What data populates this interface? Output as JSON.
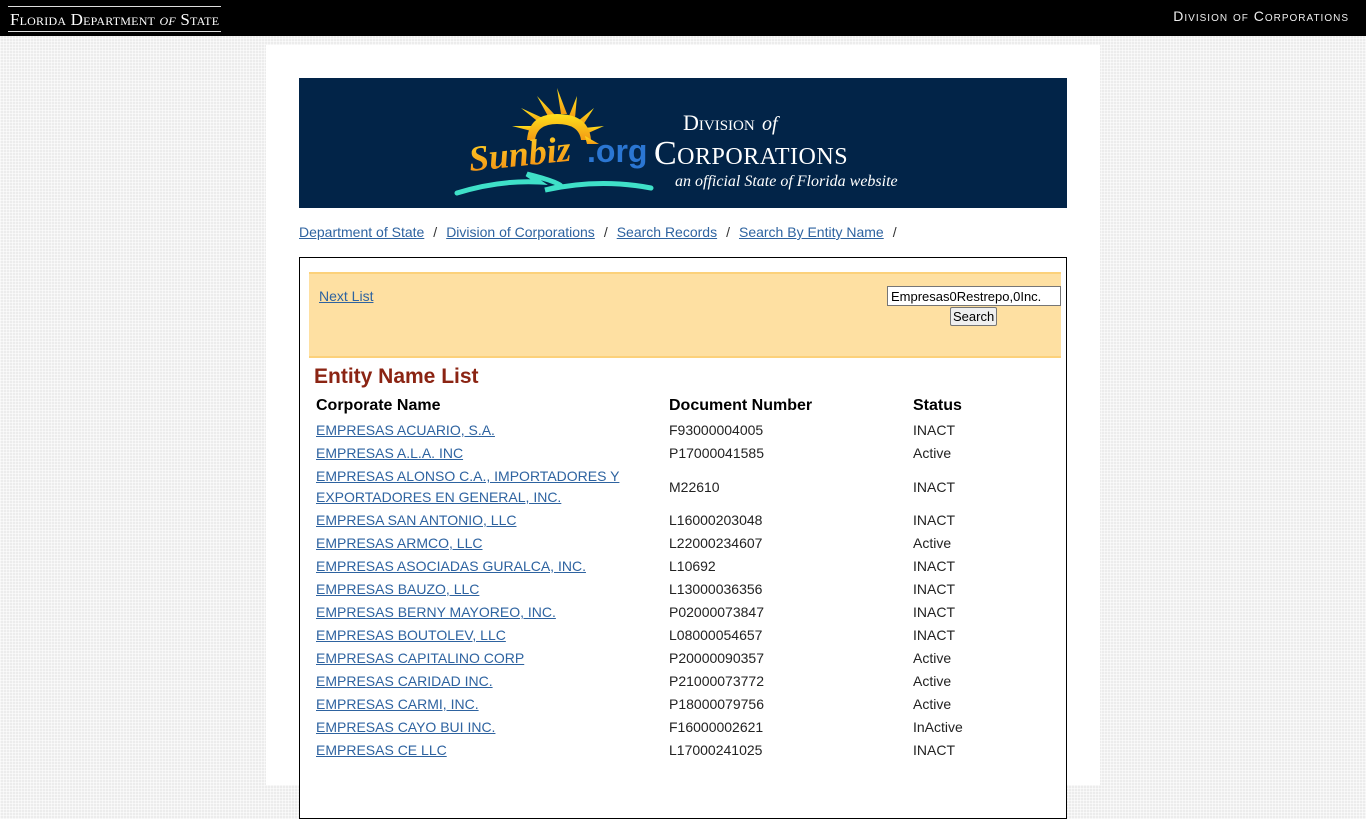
{
  "topbar": {
    "left_title_part1": "Florida Department",
    "left_title_of": "of",
    "left_title_part2": "State",
    "right_title": "Division of Corporations"
  },
  "banner": {
    "logo_text": "Sunbiz",
    "logo_suffix": ".org",
    "division_line": "Division",
    "division_of": "of",
    "corporations": "Corporations",
    "tagline": "an official State of Florida website",
    "colors": {
      "background": "#022448",
      "sun": "#f7c21a",
      "swoosh": "#3fe0c8",
      "org": "#2b76d2"
    }
  },
  "breadcrumb": [
    {
      "label": "Department of State"
    },
    {
      "label": "Division of Corporations"
    },
    {
      "label": "Search Records"
    },
    {
      "label": "Search By Entity Name"
    }
  ],
  "breadcrumb_separator": "/",
  "search": {
    "next_list_label": "Next List",
    "input_value": "Empresas0Restrepo,0Inc.",
    "button_label": "Search"
  },
  "list": {
    "title": "Entity Name List",
    "columns": [
      "Corporate Name",
      "Document Number",
      "Status"
    ],
    "rows": [
      {
        "name": "EMPRESAS ACUARIO, S.A.",
        "doc": "F93000004005",
        "status": "INACT"
      },
      {
        "name": "EMPRESAS A.L.A. INC",
        "doc": "P17000041585",
        "status": "Active"
      },
      {
        "name": "EMPRESAS ALONSO C.A., IMPORTADORES Y EXPORTADORES EN GENERAL, INC.",
        "doc": "M22610",
        "status": "INACT"
      },
      {
        "name": "EMPRESA SAN ANTONIO, LLC",
        "doc": "L16000203048",
        "status": "INACT"
      },
      {
        "name": "EMPRESAS ARMCO, LLC",
        "doc": "L22000234607",
        "status": "Active"
      },
      {
        "name": "EMPRESAS ASOCIADAS GURALCA, INC.",
        "doc": "L10692",
        "status": "INACT"
      },
      {
        "name": "EMPRESAS BAUZO, LLC",
        "doc": "L13000036356",
        "status": "INACT"
      },
      {
        "name": "EMPRESAS BERNY MAYOREO, INC.",
        "doc": "P02000073847",
        "status": "INACT"
      },
      {
        "name": "EMPRESAS BOUTOLEV, LLC",
        "doc": "L08000054657",
        "status": "INACT"
      },
      {
        "name": "EMPRESAS CAPITALINO CORP",
        "doc": "P20000090357",
        "status": "Active"
      },
      {
        "name": "EMPRESAS CARIDAD INC.",
        "doc": "P21000073772",
        "status": "Active"
      },
      {
        "name": "EMPRESAS CARMI, INC.",
        "doc": "P18000079756",
        "status": "Active"
      },
      {
        "name": "EMPRESAS CAYO BUI INC.",
        "doc": "F16000002621",
        "status": "InActive"
      },
      {
        "name": "EMPRESAS CE LLC",
        "doc": "L17000241025",
        "status": "INACT"
      }
    ]
  }
}
